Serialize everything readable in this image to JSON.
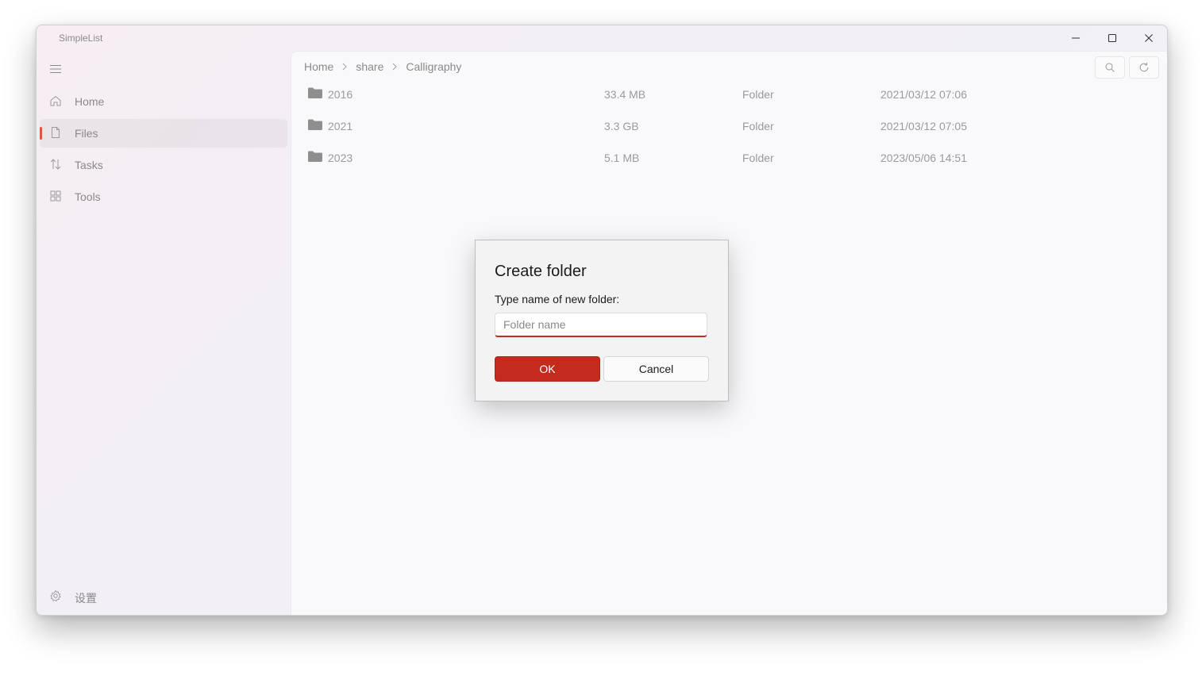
{
  "app": {
    "title": "SimpleList"
  },
  "window_controls": {
    "minimize": "minimize-icon",
    "maximize": "maximize-icon",
    "close": "close-icon"
  },
  "sidebar": {
    "items": [
      {
        "label": "Home",
        "icon": "home-icon"
      },
      {
        "label": "Files",
        "icon": "file-icon",
        "active": true
      },
      {
        "label": "Tasks",
        "icon": "transfer-icon"
      },
      {
        "label": "Tools",
        "icon": "apps-icon"
      }
    ],
    "settings_label": "设置"
  },
  "breadcrumb": [
    "Home",
    "share",
    "Calligraphy"
  ],
  "files": [
    {
      "name": "2016",
      "size": "33.4 MB",
      "type": "Folder",
      "modified": "2021/03/12 07:06"
    },
    {
      "name": "2021",
      "size": "3.3 GB",
      "type": "Folder",
      "modified": "2021/03/12 07:05"
    },
    {
      "name": "2023",
      "size": "5.1 MB",
      "type": "Folder",
      "modified": "2023/05/06 14:51"
    }
  ],
  "dialog": {
    "title": "Create folder",
    "prompt": "Type name of new folder:",
    "input_value": "",
    "input_placeholder": "Folder name",
    "ok_label": "OK",
    "cancel_label": "Cancel"
  },
  "colors": {
    "accent": "#c42b1c",
    "nav_indicator": "#e0524d"
  }
}
